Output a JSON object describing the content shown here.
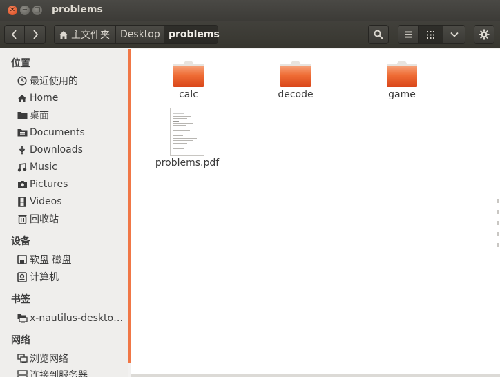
{
  "window": {
    "title": "problems",
    "controls": [
      "close",
      "minimize",
      "maximize"
    ]
  },
  "toolbar": {
    "breadcrumbs": [
      "主文件夹",
      "Desktop",
      "problems"
    ],
    "active_crumb": "problems"
  },
  "sidebar": {
    "sections": [
      {
        "title": "位置",
        "items": [
          {
            "label": "最近使用的",
            "icon": "recent-clock-icon"
          },
          {
            "label": "Home",
            "icon": "home-icon"
          },
          {
            "label": "桌面",
            "icon": "folder-icon"
          },
          {
            "label": "Documents",
            "icon": "document-icon"
          },
          {
            "label": "Downloads",
            "icon": "download-icon"
          },
          {
            "label": "Music",
            "icon": "music-icon"
          },
          {
            "label": "Pictures",
            "icon": "camera-icon"
          },
          {
            "label": "Videos",
            "icon": "film-icon"
          },
          {
            "label": "回收站",
            "icon": "trash-icon"
          }
        ]
      },
      {
        "title": "设备",
        "items": [
          {
            "label": "软盘 磁盘",
            "icon": "floppy-icon"
          },
          {
            "label": "计算机",
            "icon": "computer-icon"
          }
        ]
      },
      {
        "title": "书签",
        "items": [
          {
            "label": "x-nautilus-desktop:///",
            "icon": "desktop-bookmark-icon"
          }
        ]
      },
      {
        "title": "网络",
        "items": [
          {
            "label": "浏览网络",
            "icon": "network-icon"
          },
          {
            "label": "连接到服务器",
            "icon": "server-icon"
          }
        ]
      }
    ]
  },
  "files": [
    {
      "name": "calc",
      "type": "folder"
    },
    {
      "name": "decode",
      "type": "folder"
    },
    {
      "name": "game",
      "type": "folder"
    },
    {
      "name": "problems.pdf",
      "type": "pdf"
    }
  ],
  "colors": {
    "accent": "#f07746",
    "folder": "#e95420",
    "titlebar": "#3c3b37"
  }
}
